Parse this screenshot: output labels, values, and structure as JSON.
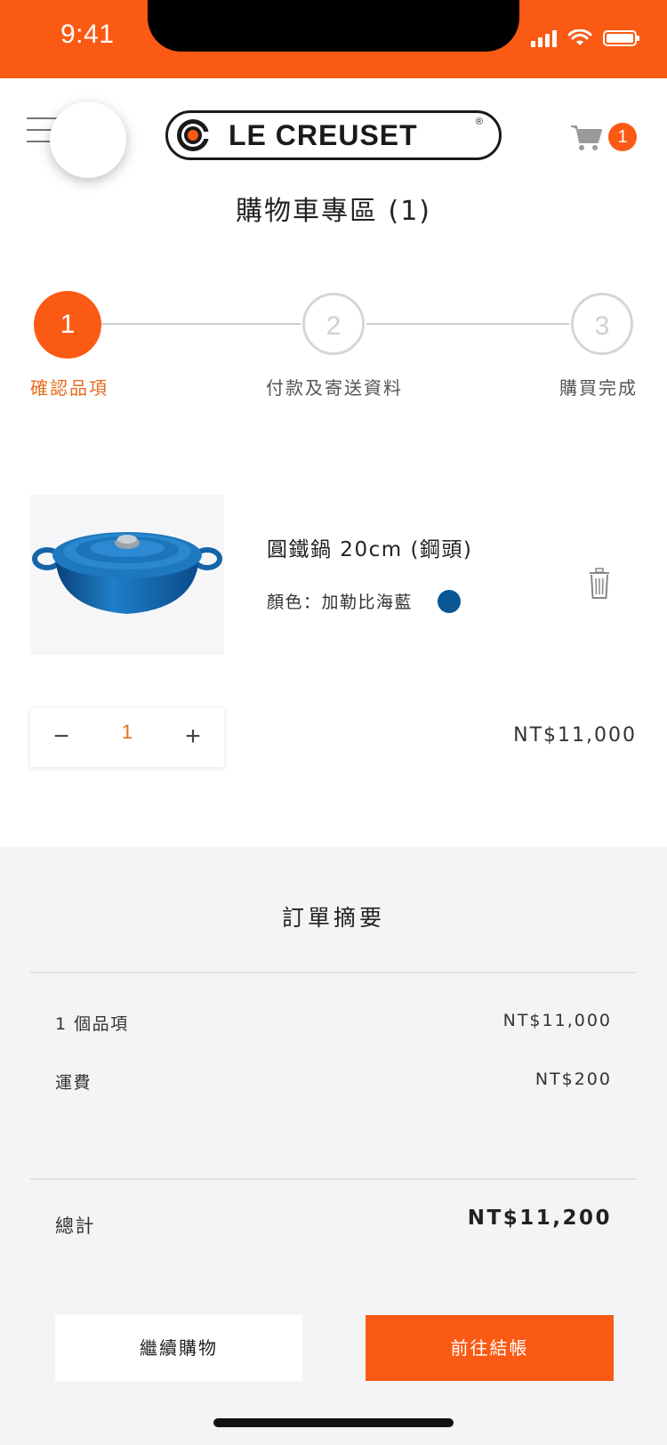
{
  "status_bar": {
    "time": "9:41",
    "background": "#fb5a14"
  },
  "header": {
    "menu_icon": "hamburger-menu-icon",
    "logo_text": "LE CREUSET",
    "logo_registered": "®",
    "cart_icon": "shopping-cart-icon",
    "cart_count": "1",
    "title": "購物車專區 (1)"
  },
  "steps": [
    {
      "number": "1",
      "label": "確認品項",
      "active": true
    },
    {
      "number": "2",
      "label": "付款及寄送資料",
      "active": false
    },
    {
      "number": "3",
      "label": "購買完成",
      "active": false
    }
  ],
  "product": {
    "name": "圓鐵鍋 20cm (鋼頭)",
    "color_text": "顏色：加勒比海藍",
    "color_swatch": "#0a5796",
    "quantity": "1",
    "minus_label": "−",
    "plus_label": "+",
    "price": "NT$11,000",
    "delete_icon": "trash-icon"
  },
  "summary": {
    "title": "訂單摘要",
    "items_label": "1 個品項",
    "items_value": "NT$11,000",
    "shipping_label": "運費",
    "shipping_value": "NT$200",
    "total_label": "總計",
    "total_value": "NT$11,200"
  },
  "buttons": {
    "continue": "繼續購物",
    "checkout": "前往結帳"
  },
  "colors": {
    "accent": "#fb5a14",
    "summary_bg": "#f4f4f5"
  }
}
